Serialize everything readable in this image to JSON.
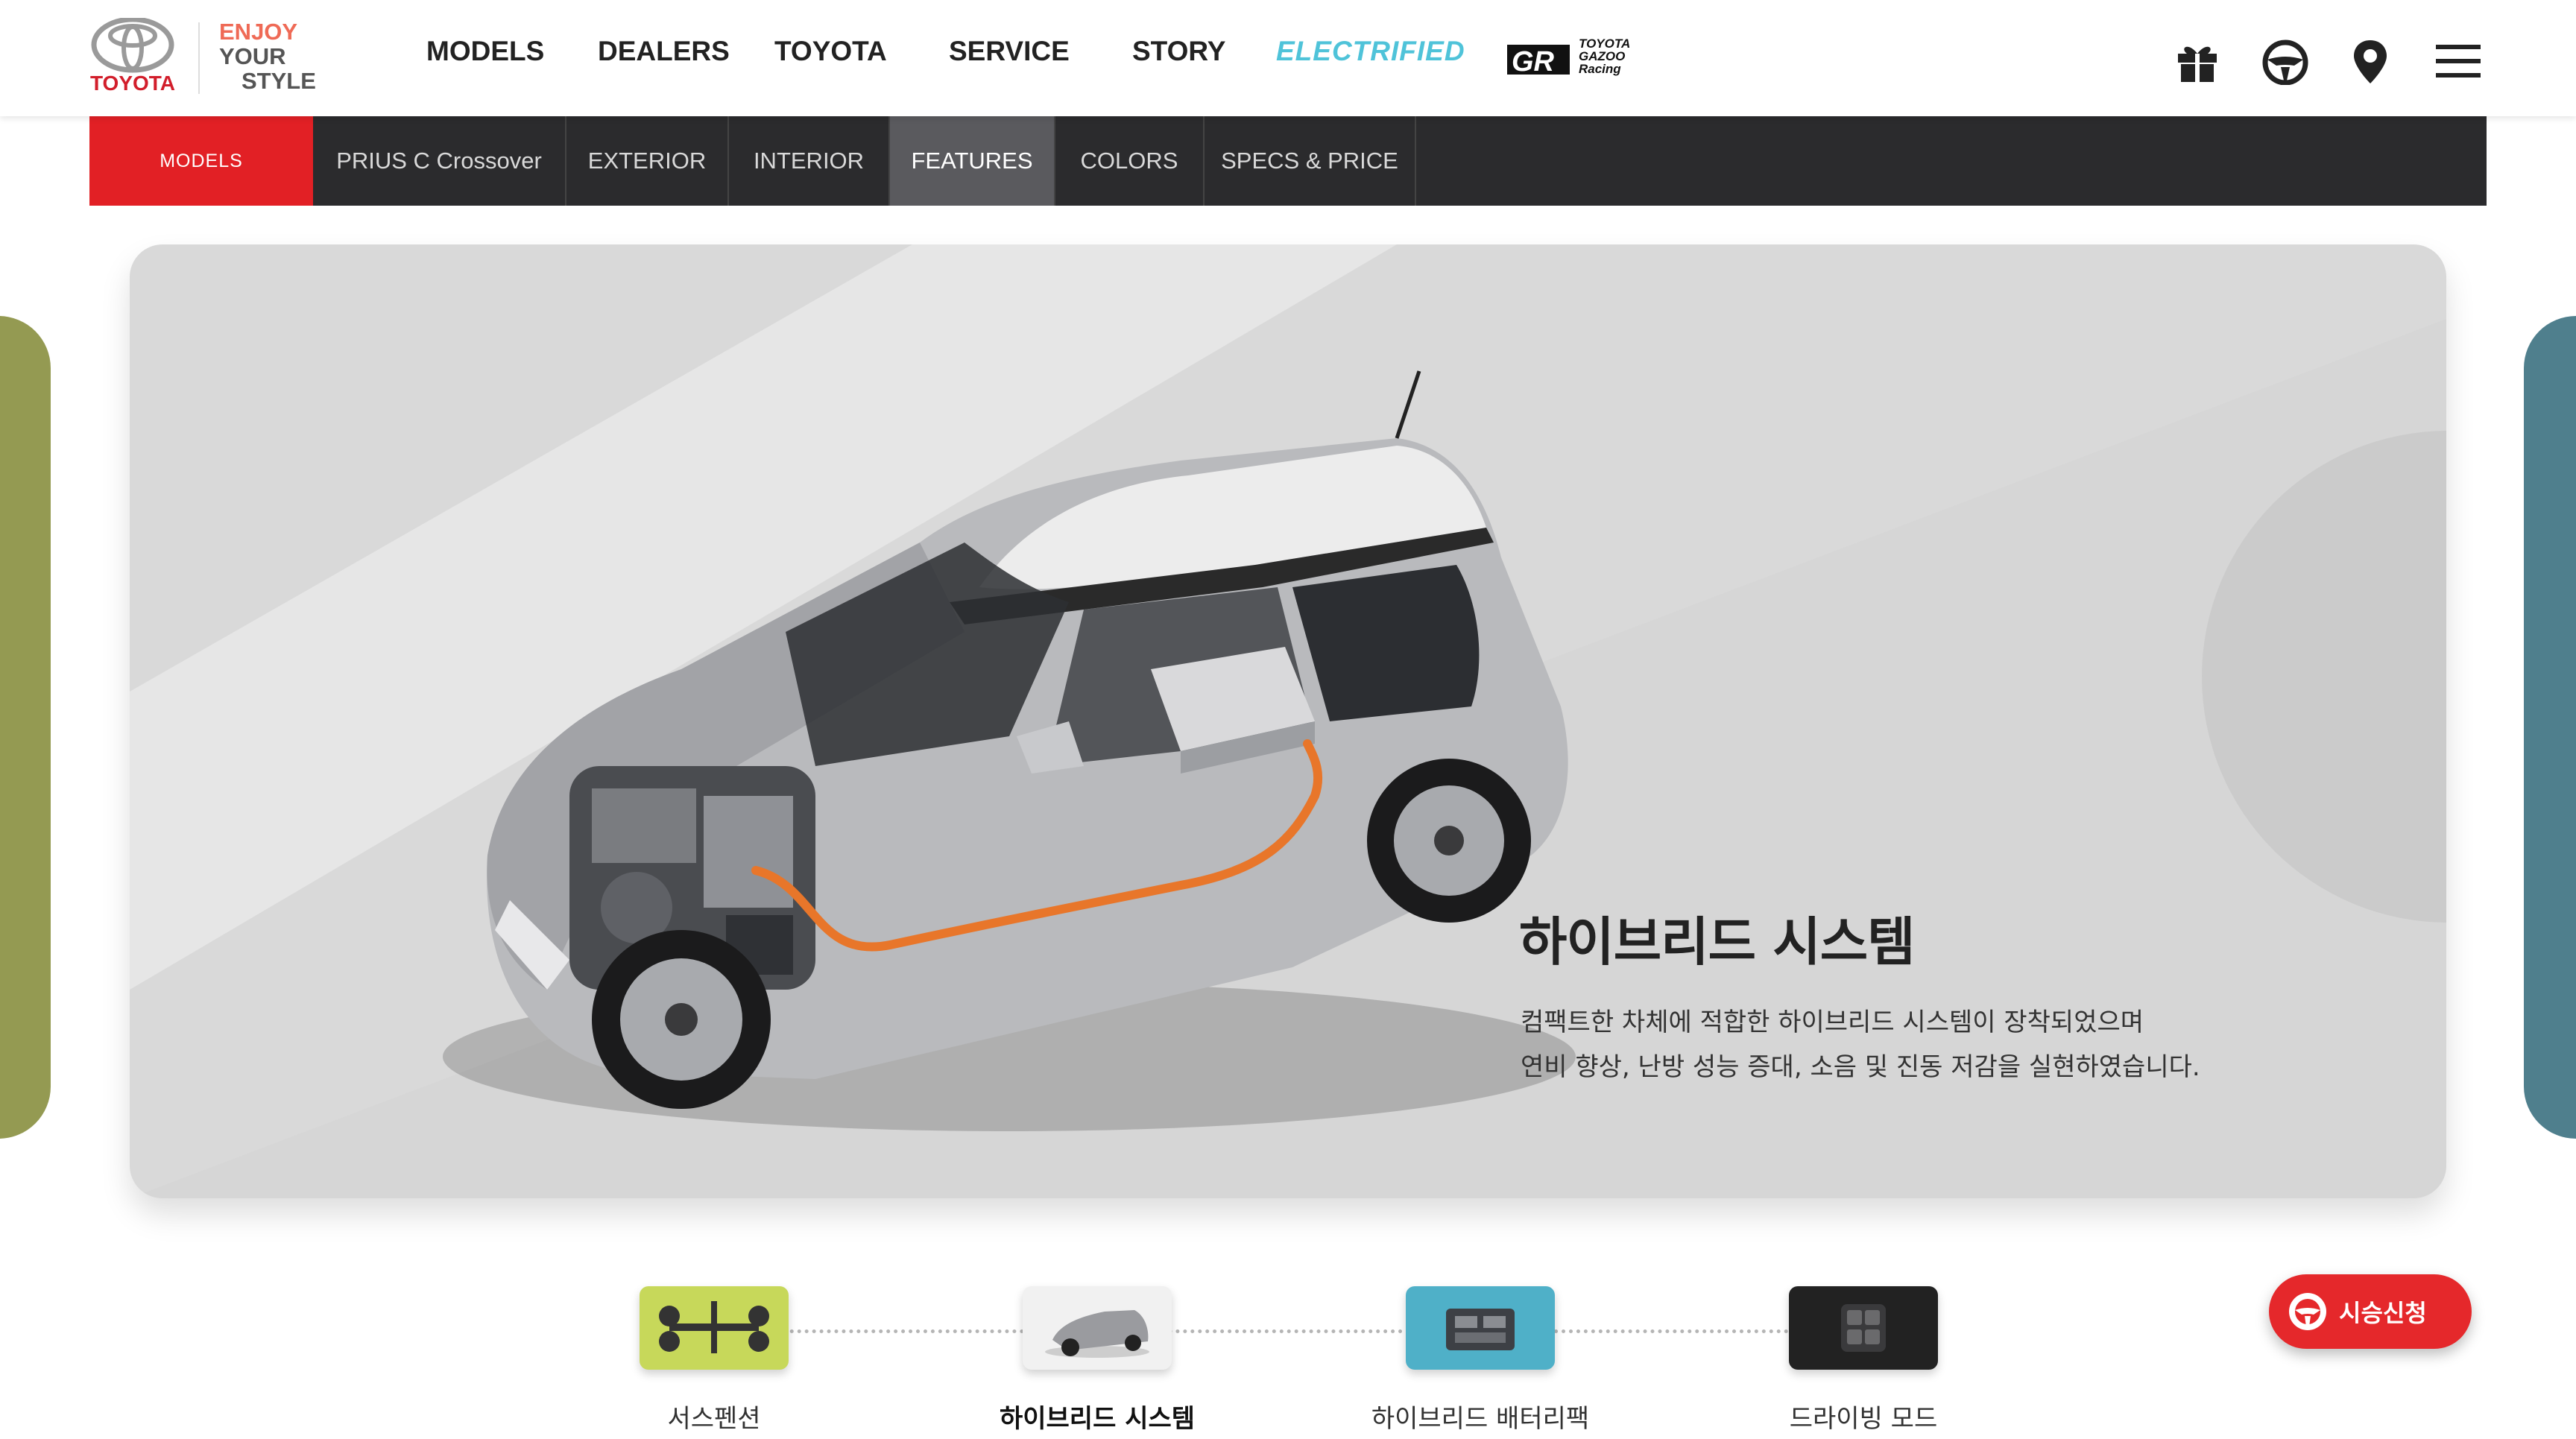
{
  "brand": {
    "name": "TOYOTA",
    "tagline_line1": "ENJOY",
    "tagline_line2": "YOUR",
    "tagline_line3": "STYLE",
    "brand_color": "#d21e2b"
  },
  "top_nav": {
    "items": [
      {
        "label": "MODELS"
      },
      {
        "label": "DEALERS"
      },
      {
        "label": "TOYOTA"
      },
      {
        "label": "SERVICE"
      },
      {
        "label": "STORY"
      },
      {
        "label": "ELECTRIFIED"
      }
    ],
    "gr_logo": {
      "mark": "GR",
      "line1": "TOYOTA",
      "line2": "GAZOO",
      "line3": "Racing"
    },
    "utility_icons": [
      "gift-icon",
      "steering-wheel-icon",
      "map-pin-icon",
      "hamburger-menu-icon"
    ]
  },
  "sub_nav": {
    "section": "MODELS",
    "tabs": [
      {
        "label": "PRIUS C Crossover",
        "active": false
      },
      {
        "label": "EXTERIOR",
        "active": false
      },
      {
        "label": "INTERIOR",
        "active": false
      },
      {
        "label": "FEATURES",
        "active": true
      },
      {
        "label": "COLORS",
        "active": false
      },
      {
        "label": "SPECS & PRICE",
        "active": false
      }
    ],
    "accent_color": "#e22025"
  },
  "feature": {
    "title": "하이브리드 시스템",
    "description_line1": "컴팩트한 차체에 적합한 하이브리드 시스템이 장착되었으며",
    "description_line2": "연비 향상, 난방 성능 증대, 소음 및 진동 저감을 실현하였습니다."
  },
  "feature_thumbnails": [
    {
      "label": "서스펜션",
      "active": false,
      "color": "#c7d85a"
    },
    {
      "label": "하이브리드 시스템",
      "active": true,
      "color": "#f1f1f1"
    },
    {
      "label": "하이브리드 배터리팩",
      "active": false,
      "color": "#4fb0c8"
    },
    {
      "label": "드라이빙 모드",
      "active": false,
      "color": "#222222"
    }
  ],
  "test_drive": {
    "label": "시승신청",
    "color": "#e5282b"
  },
  "side_peeks": {
    "left_color": "#949a52",
    "right_color": "#4f7f8d"
  }
}
